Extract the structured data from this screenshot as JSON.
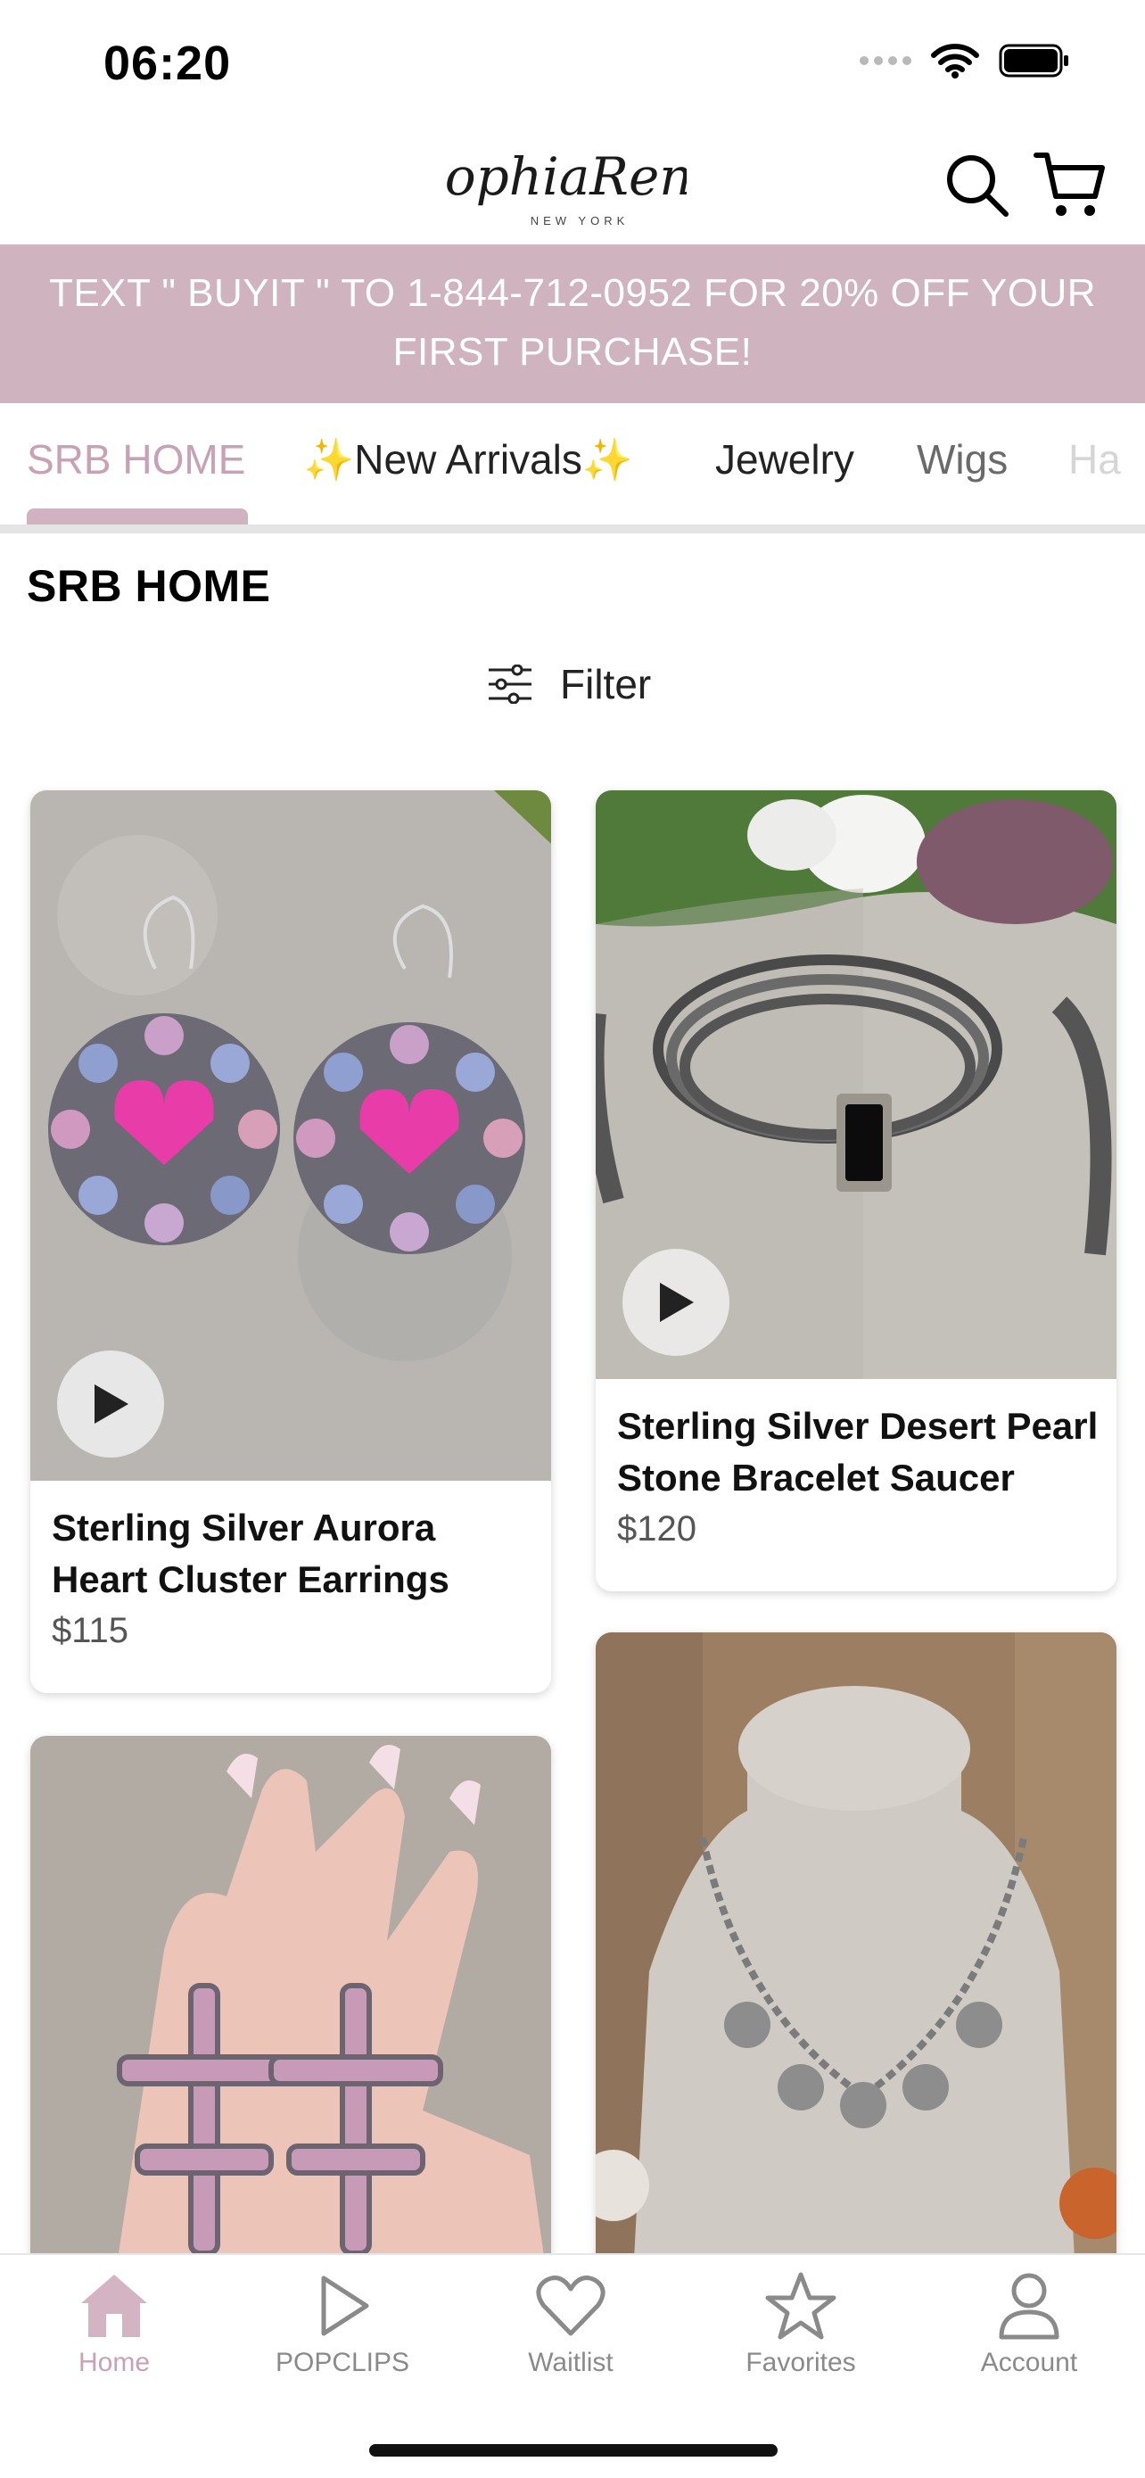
{
  "status_bar": {
    "time": "06:20"
  },
  "header": {
    "brand_script": "SophiaRené",
    "brand_sub": "NEW YORK"
  },
  "promo": {
    "text": "TEXT \" BUYIT \" TO 1-844-712-0952 FOR 20% OFF YOUR FIRST PURCHASE!"
  },
  "tabs": [
    {
      "label": "SRB HOME",
      "active": true
    },
    {
      "label": "✨New Arrivals✨",
      "active": false
    },
    {
      "label": "Jewelry",
      "active": false
    },
    {
      "label": "Wigs",
      "active": false
    },
    {
      "label": "Ha",
      "active": false
    }
  ],
  "section": {
    "title": "SRB HOME",
    "filter_label": "Filter"
  },
  "products": [
    {
      "title": "Sterling Silver Aurora Heart Cluster Earrings",
      "price": "$115",
      "has_video": true
    },
    {
      "title": "Sterling Silver Desert Pearl Stone Bracelet Saucer",
      "price": "$120",
      "has_video": true
    },
    {
      "title": "",
      "price": "",
      "has_video": false
    },
    {
      "title": "",
      "price": "",
      "has_video": false
    }
  ],
  "bottom_nav": [
    {
      "label": "Home",
      "icon": "home-icon",
      "active": true
    },
    {
      "label": "POPCLIPS",
      "icon": "play-outline-icon",
      "active": false
    },
    {
      "label": "Waitlist",
      "icon": "heart-icon",
      "active": false
    },
    {
      "label": "Favorites",
      "icon": "star-icon",
      "active": false
    },
    {
      "label": "Account",
      "icon": "person-icon",
      "active": false
    }
  ],
  "colors": {
    "accent": "#cfb3bf",
    "active_tab": "#c9a1b5",
    "text": "#111111"
  }
}
